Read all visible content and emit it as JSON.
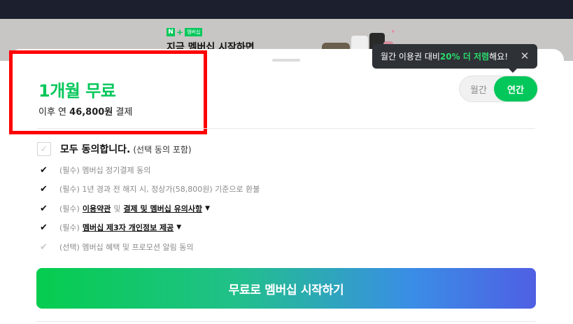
{
  "banner": {
    "logo_n": "N",
    "logo_plus": "+",
    "logo_text": "멤버십",
    "title": "지금 멤버십 시작하면"
  },
  "plan": {
    "title": "1개월 무료",
    "sub_prefix": "이후 연 ",
    "sub_price": "46,800원",
    "sub_suffix": " 결제"
  },
  "tooltip": {
    "prefix": "월간 이용권 대비 ",
    "highlight": "20% 더 저렴",
    "suffix": "해요!",
    "close": "✕"
  },
  "toggle": {
    "monthly": "월간",
    "yearly": "연간"
  },
  "agreement": {
    "all_label": "모두 동의합니다.",
    "all_note": "(선택 동의 포함)",
    "terms": [
      {
        "text": "(필수) 멤버십 정기결제 동의"
      },
      {
        "text": "(필수) 1년 경과 전 해지 시, 정상가(58,800원) 기준으로 환불"
      },
      {
        "prefix": "(필수)",
        "link1": "이용약관",
        "mid": "및",
        "link2": "결제 및 멤버십 유의사항"
      },
      {
        "prefix": "(필수)",
        "link1": "멤버십 제3자 개인정보 제공"
      },
      {
        "text": "(선택) 멤버십 혜택 및 프로모션 알림 동의"
      }
    ]
  },
  "cta": {
    "label": "무료로 멤버십 시작하기"
  },
  "icons": {
    "check": "✓",
    "checkmark": "✔",
    "chevron": "⌄"
  },
  "colors": {
    "accent": "#03c75a",
    "tooltip_bg": "#2e3237",
    "highlight_border": "#ff0000"
  }
}
